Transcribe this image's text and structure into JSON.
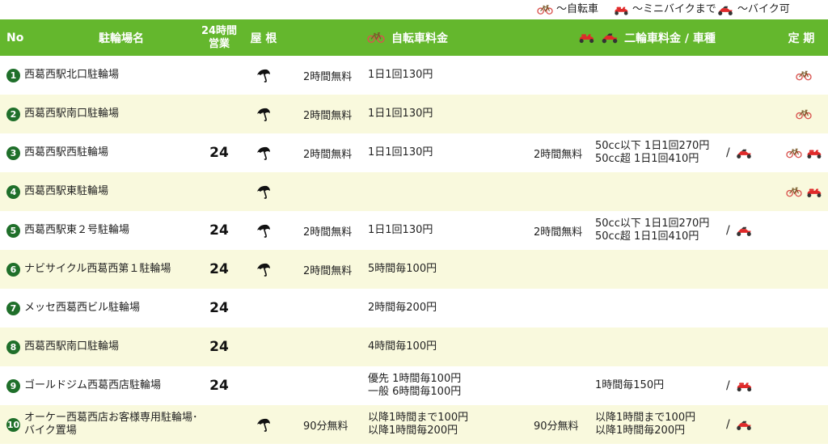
{
  "legend": {
    "bicycle": "～自転車",
    "minibike": "～ミニバイクまで",
    "bike": "～バイク可"
  },
  "header": {
    "no": "No",
    "name": "駐輪場名",
    "open24_line1": "24時間",
    "open24_line2": "営業",
    "roof": "屋 根",
    "bicycle_fee": "自転車料金",
    "motorcycle_fee": "二輪車料金 / 車種",
    "pass": "定 期"
  },
  "colors": {
    "header_bg": "#64b72d",
    "row_alt": "#f9f9dd",
    "number_badge": "#1f6f2a",
    "bike_red": "#e02a2a"
  },
  "rows": [
    {
      "no": "1",
      "name": "西葛西駅北口駐輪場",
      "open24": "",
      "roof": true,
      "bike_free": "2時間無料",
      "bike_fee1": "1日1回130円",
      "bike_fee2": "",
      "moto_free": "",
      "moto_fee1": "",
      "moto_fee2": "",
      "moto_type": "",
      "slash": "",
      "pass": [
        "bicycle"
      ]
    },
    {
      "no": "2",
      "name": "西葛西駅南口駐輪場",
      "open24": "",
      "roof": true,
      "bike_free": "2時間無料",
      "bike_fee1": "1日1回130円",
      "bike_fee2": "",
      "moto_free": "",
      "moto_fee1": "",
      "moto_fee2": "",
      "moto_type": "",
      "slash": "",
      "pass": [
        "bicycle"
      ]
    },
    {
      "no": "3",
      "name": "西葛西駅西駐輪場",
      "open24": "24",
      "roof": true,
      "bike_free": "2時間無料",
      "bike_fee1": "1日1回130円",
      "bike_fee2": "",
      "moto_free": "2時間無料",
      "moto_fee1": "50cc以下 1日1回270円",
      "moto_fee2": "50cc超 1日1回410円",
      "moto_type": "bike",
      "slash": "/",
      "pass": [
        "bicycle",
        "minibike"
      ]
    },
    {
      "no": "4",
      "name": "西葛西駅東駐輪場",
      "open24": "",
      "roof": true,
      "bike_free": "",
      "bike_fee1": "",
      "bike_fee2": "",
      "moto_free": "",
      "moto_fee1": "",
      "moto_fee2": "",
      "moto_type": "",
      "slash": "",
      "pass": [
        "bicycle",
        "minibike"
      ]
    },
    {
      "no": "5",
      "name": "西葛西駅東２号駐輪場",
      "open24": "24",
      "roof": true,
      "bike_free": "2時間無料",
      "bike_fee1": "1日1回130円",
      "bike_fee2": "",
      "moto_free": "2時間無料",
      "moto_fee1": "50cc以下 1日1回270円",
      "moto_fee2": "50cc超 1日1回410円",
      "moto_type": "bike",
      "slash": "/",
      "pass": []
    },
    {
      "no": "6",
      "name": "ナビサイクル西葛西第１駐輪場",
      "open24": "24",
      "roof": true,
      "bike_free": "2時間無料",
      "bike_fee1": "5時間毎100円",
      "bike_fee2": "",
      "moto_free": "",
      "moto_fee1": "",
      "moto_fee2": "",
      "moto_type": "",
      "slash": "",
      "pass": []
    },
    {
      "no": "7",
      "name": "メッセ西葛西ビル駐輪場",
      "open24": "24",
      "roof": false,
      "bike_free": "",
      "bike_fee1": "2時間毎200円",
      "bike_fee2": "",
      "moto_free": "",
      "moto_fee1": "",
      "moto_fee2": "",
      "moto_type": "",
      "slash": "",
      "pass": []
    },
    {
      "no": "8",
      "name": "西葛西駅南口駐輪場",
      "open24": "24",
      "roof": false,
      "bike_free": "",
      "bike_fee1": "4時間毎100円",
      "bike_fee2": "",
      "moto_free": "",
      "moto_fee1": "",
      "moto_fee2": "",
      "moto_type": "",
      "slash": "",
      "pass": []
    },
    {
      "no": "9",
      "name": "ゴールドジム西葛西店駐輪場",
      "open24": "24",
      "roof": false,
      "bike_free": "",
      "bike_fee1": "優先 1時間毎100円",
      "bike_fee2": "一般 6時間毎100円",
      "moto_free": "",
      "moto_fee1": "1時間毎150円",
      "moto_fee2": "",
      "moto_type": "minibike",
      "slash": "/",
      "pass": []
    },
    {
      "no": "10",
      "name": "オーケー西葛西店お客様専用駐輪場･バイク置場",
      "open24": "",
      "roof": true,
      "bike_free": "90分無料",
      "bike_fee1": "以降1時間まで100円",
      "bike_fee2": "以降1時間毎200円",
      "moto_free": "90分無料",
      "moto_fee1": "以降1時間まで100円",
      "moto_fee2": "以降1時間毎200円",
      "moto_type": "bike",
      "slash": "/",
      "pass": []
    }
  ]
}
